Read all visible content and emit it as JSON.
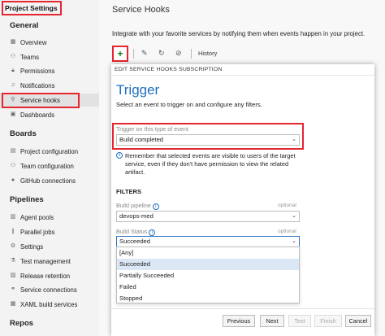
{
  "sidebar": {
    "title": "Project Settings",
    "sections": [
      {
        "heading": "General",
        "items": [
          {
            "label": "Overview",
            "icon": "overview-icon"
          },
          {
            "label": "Teams",
            "icon": "teams-icon"
          },
          {
            "label": "Permissions",
            "icon": "lock-icon"
          },
          {
            "label": "Notifications",
            "icon": "bell-icon"
          },
          {
            "label": "Service hooks",
            "icon": "hook-icon",
            "active": true
          },
          {
            "label": "Dashboards",
            "icon": "dashboard-icon"
          }
        ]
      },
      {
        "heading": "Boards",
        "items": [
          {
            "label": "Project configuration",
            "icon": "settings-doc-icon"
          },
          {
            "label": "Team configuration",
            "icon": "team-config-icon"
          },
          {
            "label": "GitHub connections",
            "icon": "github-icon"
          }
        ]
      },
      {
        "heading": "Pipelines",
        "items": [
          {
            "label": "Agent pools",
            "icon": "agent-pool-icon"
          },
          {
            "label": "Parallel jobs",
            "icon": "parallel-icon"
          },
          {
            "label": "Settings",
            "icon": "gear-icon"
          },
          {
            "label": "Test management",
            "icon": "test-icon"
          },
          {
            "label": "Release retention",
            "icon": "retention-icon"
          },
          {
            "label": "Service connections",
            "icon": "connection-icon"
          },
          {
            "label": "XAML build services",
            "icon": "xaml-icon"
          }
        ]
      },
      {
        "heading": "Repos",
        "items": []
      }
    ]
  },
  "main": {
    "title": "Service Hooks",
    "intro": "Integrate with your favorite services by notifying them when events happen in your project.",
    "toolbar": {
      "add": "+",
      "edit_icon": "pencil-icon",
      "refresh_icon": "refresh-icon",
      "history": "History"
    }
  },
  "dialog": {
    "header": "EDIT SERVICE HOOKS SUBSCRIPTION",
    "title": "Trigger",
    "subtitle": "Select an event to trigger on and configure any filters.",
    "trigger_label": "Trigger on this type of event",
    "trigger_value": "Build completed",
    "note": "Remember that selected events are visible to users of the target service, even if they don't have permission to view the related artifact.",
    "filters_heading": "FILTERS",
    "build_pipeline_label": "Build pipeline",
    "build_pipeline_optional": "optional",
    "build_pipeline_value": "devops-med",
    "build_status_label": "Build Status",
    "build_status_optional": "optional",
    "build_status_value": "Succeeded",
    "build_status_options": [
      "[Any]",
      "Succeeded",
      "Partially Succeeded",
      "Failed",
      "Stopped"
    ],
    "highlighted_option": 1,
    "footer": {
      "previous": "Previous",
      "next": "Next",
      "test": "Test",
      "finish": "Finish",
      "cancel": "Cancel"
    }
  },
  "colors": {
    "highlight_red": "#e4262f",
    "accent_blue": "#1e6fbf",
    "add_green": "#107c10"
  }
}
